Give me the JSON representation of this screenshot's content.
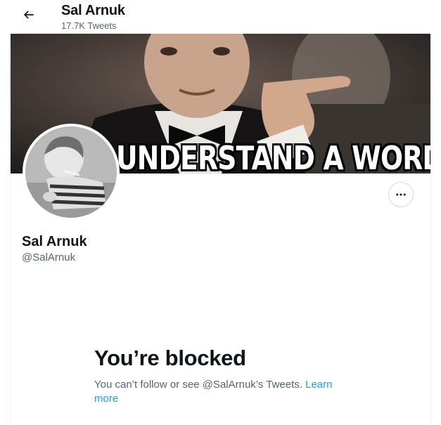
{
  "header": {
    "name": "Sal Arnuk",
    "tweet_count": "17.7K Tweets",
    "back_icon": "arrow-left-icon"
  },
  "banner": {
    "caption": "UNDERSTAND A WORD!"
  },
  "profile": {
    "name": "Sal Arnuk",
    "handle": "@SalArnuk",
    "more_icon": "more-dots-icon"
  },
  "blocked": {
    "title": "You’re blocked",
    "message": "You can’t follow or see @SalArnuk’s Tweets.",
    "learn_more": "Learn more"
  },
  "colors": {
    "text_primary": "#0f1419",
    "text_secondary": "#536471",
    "link": "#1d9bf0",
    "border": "#cfd9de"
  }
}
